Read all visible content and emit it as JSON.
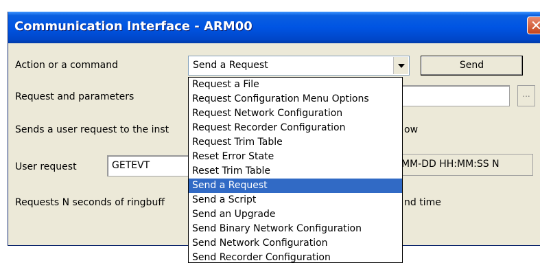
{
  "window": {
    "title": "Communication Interface - ARM00"
  },
  "action": {
    "label": "Action or a command",
    "selected": "Send a Request",
    "send_label": "Send"
  },
  "request_params": {
    "label": "Request and parameters",
    "browse_label": "..."
  },
  "description": {
    "text_left": "Sends a user request to the inst",
    "text_right": "ow"
  },
  "user_request": {
    "label": "User request",
    "value": "GETEVT",
    "format_hint": "MM-DD HH:MM:SS N"
  },
  "requests_desc": {
    "text_left": "Requests N seconds of ringbuff",
    "text_right": "nd time"
  },
  "dropdown": {
    "items": [
      {
        "label": "Request a File"
      },
      {
        "label": "Request Configuration Menu Options"
      },
      {
        "label": "Request Network Configuration"
      },
      {
        "label": "Request Recorder Configuration"
      },
      {
        "label": "Request Trim Table"
      },
      {
        "label": "Reset Error State"
      },
      {
        "label": "Reset Trim Table"
      },
      {
        "label": "Send a Request",
        "selected": true
      },
      {
        "label": "Send a Script"
      },
      {
        "label": "Send an Upgrade"
      },
      {
        "label": "Send Binary Network Configuration"
      },
      {
        "label": "Send Network Configuration"
      },
      {
        "label": "Send Recorder Configuration"
      }
    ]
  },
  "colors": {
    "titlebar": "#0054e3",
    "window_bg": "#ece9d8",
    "selection": "#316ac5",
    "close": "#c4441c"
  },
  "icons": {
    "close": "close-icon",
    "dropdown": "chevron-down-icon"
  }
}
